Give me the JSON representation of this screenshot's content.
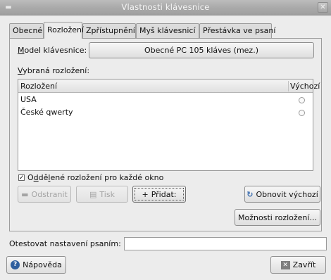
{
  "window": {
    "title": "Vlastnosti klávesnice",
    "menu_icon": "window-menu-icon",
    "close_icon": "close-icon"
  },
  "tabs": [
    {
      "label": "Obecné",
      "active": false
    },
    {
      "label": "Rozložení",
      "active": true
    },
    {
      "label": "Zpřístupnění",
      "active": false
    },
    {
      "label": "Myš klávesnicí",
      "active": false
    },
    {
      "label": "Přestávka ve psaní",
      "active": false
    }
  ],
  "layout_tab": {
    "model_label": "Model klávesnice:",
    "model_value": "Obecné PC 105 kláves (mez.)",
    "selected_layouts_label": "Vybraná rozložení:",
    "table": {
      "columns": [
        "Rozložení",
        "Výchozí"
      ],
      "rows": [
        {
          "name": "USA",
          "default": false
        },
        {
          "name": "České qwerty",
          "default": false
        }
      ]
    },
    "separate_layout_checkbox": {
      "label": "Oddělené rozložení pro každé okno",
      "checked": true
    },
    "buttons": {
      "remove": "Odstranit",
      "print": "Tisk",
      "add": "Přidat:",
      "reset": "Obnovit výchozí",
      "options": "Možnosti rozložení..."
    }
  },
  "test_typing": {
    "label": "Otestovat nastavení psaním:",
    "value": ""
  },
  "footer": {
    "help": "Nápověda",
    "close": "Zavřít"
  },
  "colors": {
    "titlebar": "#a9a9a9",
    "window_bg": "#ececec",
    "help_icon": "#2f5f9e",
    "reset_icon": "#3b6db0"
  }
}
